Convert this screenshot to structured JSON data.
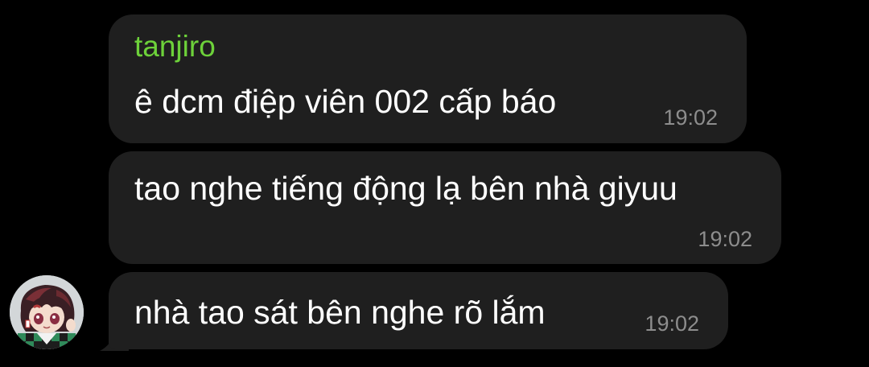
{
  "messages": [
    {
      "sender": "tanjiro",
      "text": "ê dcm điệp viên 002 cấp báo",
      "time": "19:02"
    },
    {
      "text": "tao nghe tiếng động lạ bên nhà giyuu",
      "time": "19:02"
    },
    {
      "text": "nhà tao sát bên nghe rõ lắm",
      "time": "19:02"
    }
  ],
  "colors": {
    "background": "#000000",
    "bubble": "#1f1f1f",
    "sender": "#6dd13a",
    "text": "#ffffff",
    "time": "#8d8d8d"
  },
  "avatar": {
    "icon": "anime-character-avatar"
  }
}
